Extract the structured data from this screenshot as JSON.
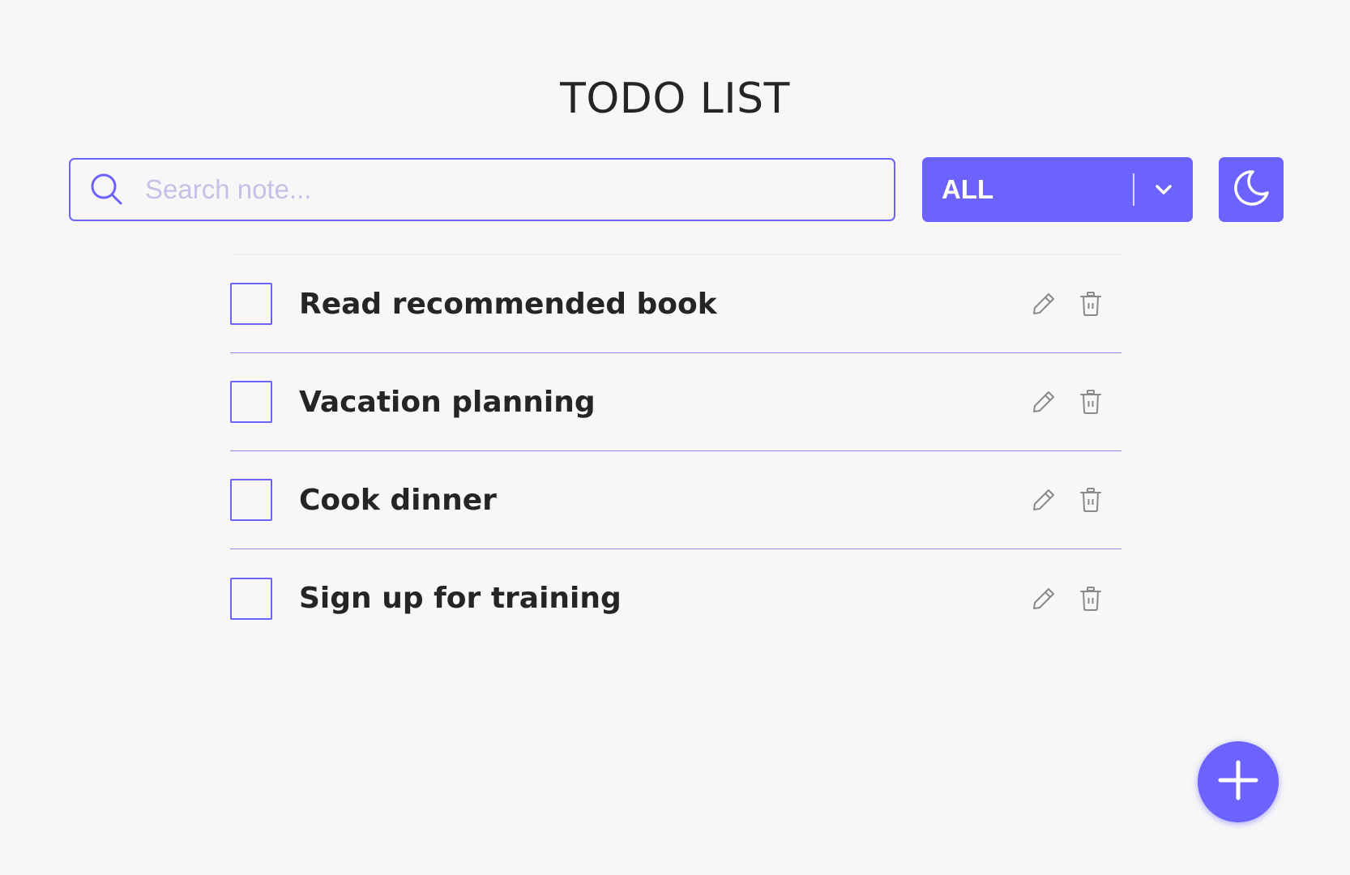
{
  "app": {
    "title": "TODO LIST"
  },
  "search": {
    "placeholder": "Search note...",
    "value": "",
    "icon": "search-icon"
  },
  "filter": {
    "selected": "ALL",
    "icon": "chevron-down-icon"
  },
  "theme_toggle": {
    "icon": "moon-icon"
  },
  "todos": [
    {
      "label": "Read recommended book",
      "checked": false
    },
    {
      "label": "Vacation planning",
      "checked": false
    },
    {
      "label": "Cook dinner",
      "checked": false
    },
    {
      "label": "Sign up for training",
      "checked": false
    }
  ],
  "row_actions": {
    "edit_icon": "pencil-icon",
    "delete_icon": "trash-icon"
  },
  "add_button": {
    "icon": "plus-icon"
  },
  "colors": {
    "accent": "#6c63ff",
    "background": "#f7f7f7",
    "text": "#252525",
    "placeholder": "#c3c1e5",
    "icon_gray": "#8a8a8a"
  }
}
